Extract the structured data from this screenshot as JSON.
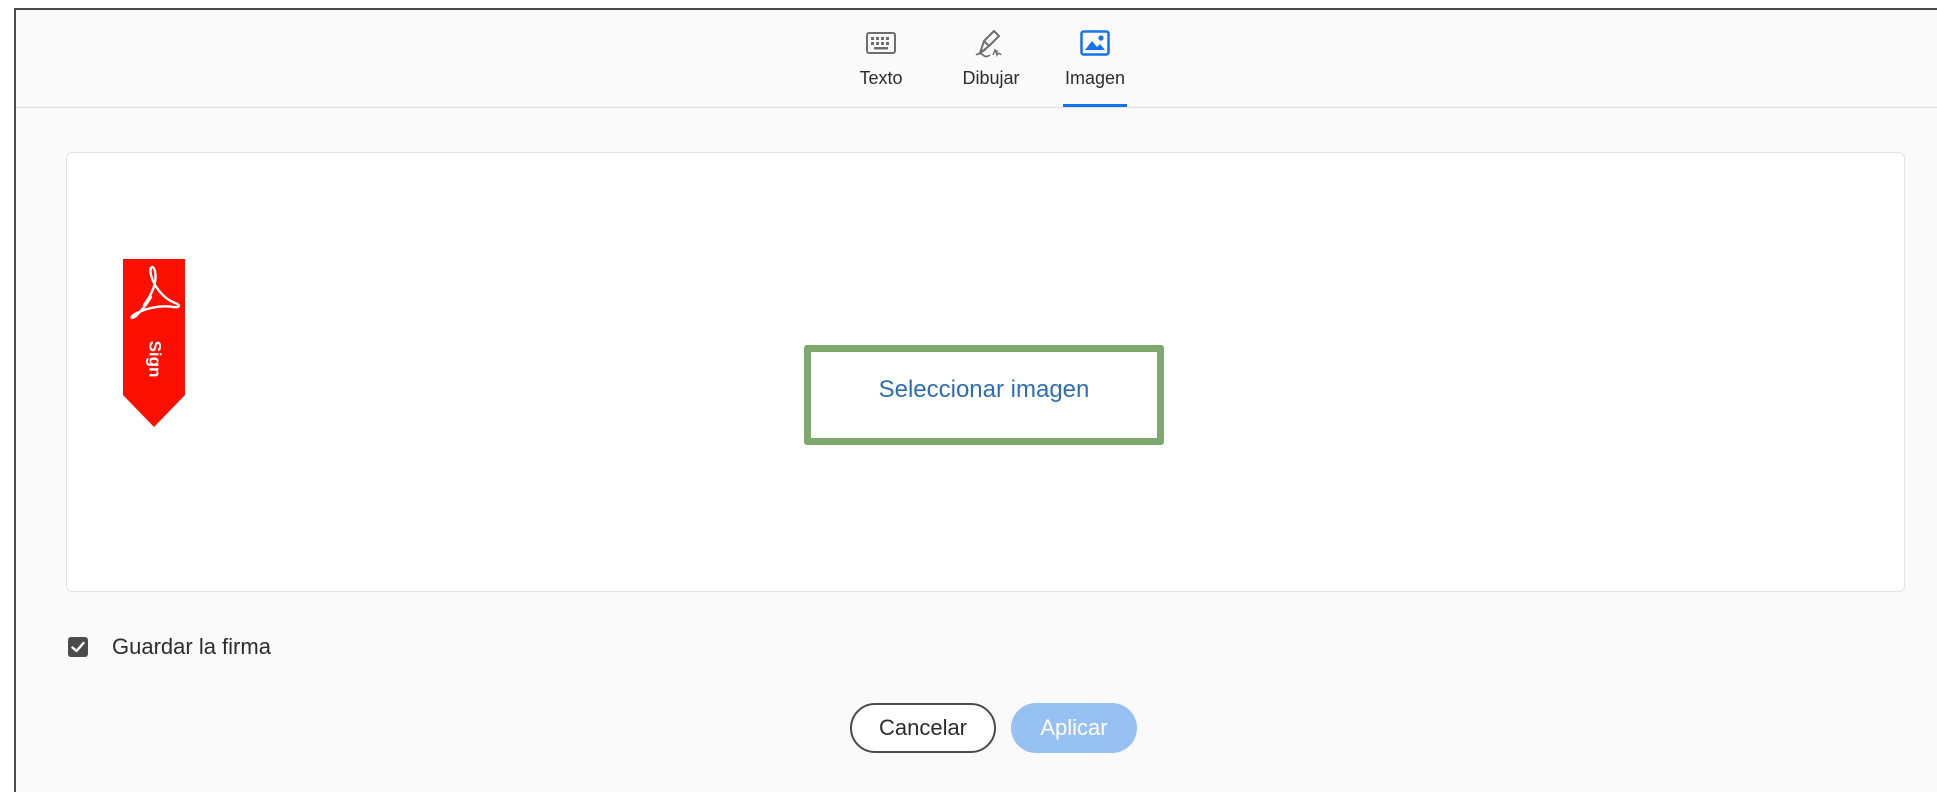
{
  "tabs": [
    {
      "label": "Texto",
      "icon": "keyboard-icon",
      "active": false
    },
    {
      "label": "Dibujar",
      "icon": "pen-draw-icon",
      "active": false
    },
    {
      "label": "Imagen",
      "icon": "image-icon",
      "active": true
    }
  ],
  "image_panel": {
    "preview_badge_text": "Sign",
    "select_image_label": "Seleccionar imagen"
  },
  "save_signature": {
    "label": "Guardar la firma",
    "checked": true
  },
  "buttons": {
    "cancel_label": "Cancelar",
    "apply_label": "Aplicar"
  },
  "colors": {
    "accent": "#1473e6",
    "link": "#2d6db5",
    "highlight_frame": "#7fa86e",
    "apply_disabled": "#97c1f2",
    "badge_red": "#fa0f00"
  }
}
